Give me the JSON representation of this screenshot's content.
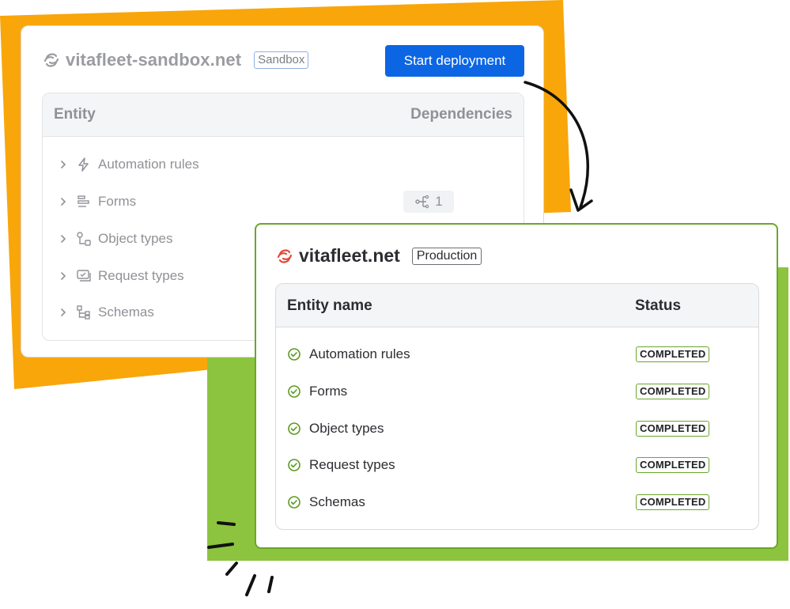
{
  "colors": {
    "orange_backdrop": "#f9a60a",
    "green_backdrop": "#8cc43f",
    "primary_button": "#0c66e4",
    "production_border": "#6aa729"
  },
  "sandbox": {
    "site_name": "vitafleet-sandbox.net",
    "environment": "Sandbox",
    "deploy_button": "Start deployment",
    "table": {
      "col_entity": "Entity",
      "col_dependencies": "Dependencies",
      "rows": [
        {
          "label": "Automation rules",
          "icon": "lightning-icon"
        },
        {
          "label": "Forms",
          "icon": "form-icon",
          "dependencies": "1"
        },
        {
          "label": "Object types",
          "icon": "object-type-icon"
        },
        {
          "label": "Request types",
          "icon": "request-type-icon"
        },
        {
          "label": "Schemas",
          "icon": "schema-icon"
        }
      ]
    }
  },
  "production": {
    "site_name": "vitafleet.net",
    "environment": "Production",
    "table": {
      "col_entity": "Entity name",
      "col_status": "Status",
      "rows": [
        {
          "label": "Automation rules",
          "status": "COMPLETED"
        },
        {
          "label": "Forms",
          "status": "COMPLETED"
        },
        {
          "label": "Object types",
          "status": "COMPLETED"
        },
        {
          "label": "Request types",
          "status": "COMPLETED"
        },
        {
          "label": "Schemas",
          "status": "COMPLETED"
        }
      ]
    }
  }
}
